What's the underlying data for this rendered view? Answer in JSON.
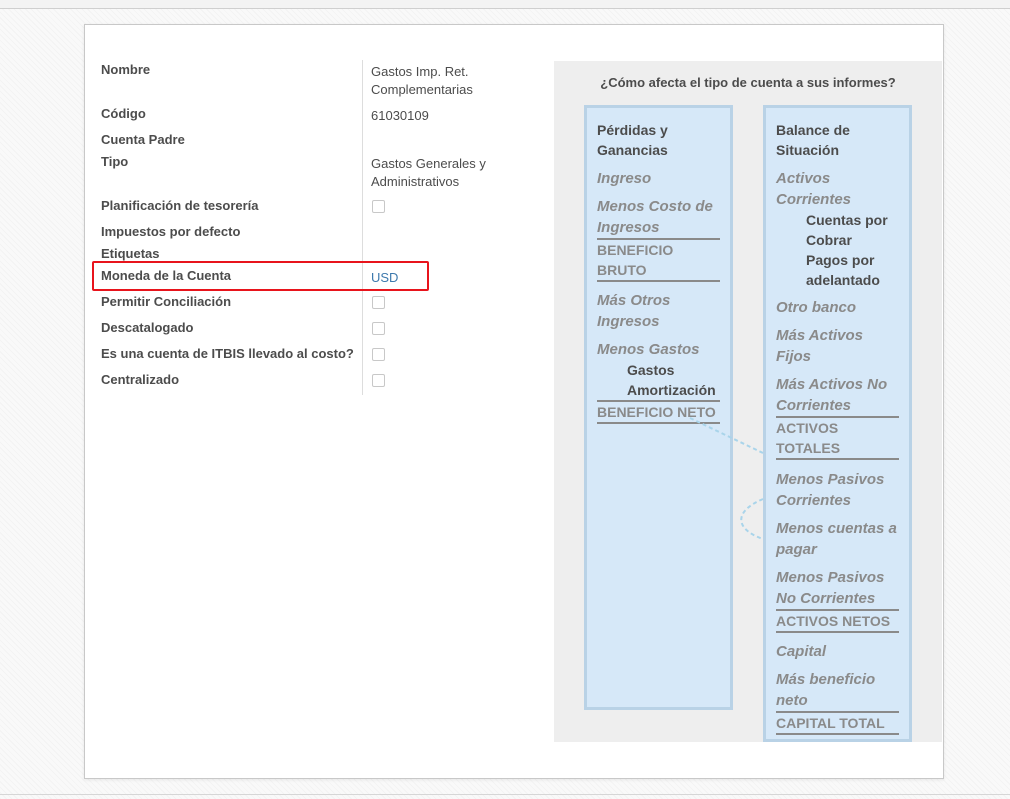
{
  "form": {
    "fields": [
      {
        "label": "Nombre",
        "value": "Gastos Imp. Ret. Complementarias"
      },
      {
        "label": "Código",
        "value": "61030109"
      },
      {
        "label": "Cuenta Padre",
        "value": ""
      },
      {
        "label": "Tipo",
        "value": "Gastos Generales y Administrativos"
      },
      {
        "label": "Planificación de tesorería",
        "checked": false
      },
      {
        "label": "Impuestos por defecto",
        "value": ""
      },
      {
        "label": "Etiquetas",
        "value": ""
      },
      {
        "label": "Moneda de la Cuenta",
        "value": "USD"
      },
      {
        "label": "Permitir Conciliación",
        "checked": false
      },
      {
        "label": "Descatalogado",
        "checked": false
      },
      {
        "label": "Es una cuenta de ITBIS llevado al costo?",
        "checked": false
      },
      {
        "label": "Centralizado",
        "checked": false
      }
    ]
  },
  "panel": {
    "title": "¿Cómo afecta el tipo de cuenta a sus informes?",
    "left": {
      "heading": "Pérdidas y Ganancias",
      "ingreso": "Ingreso",
      "menos_costo": "Menos Costo de Ingresos",
      "beneficio_bruto": "BENEFICIO BRUTO",
      "mas_otros": "Más Otros Ingresos",
      "menos_gastos": "Menos Gastos",
      "gastos_sub": "Gastos",
      "amortizacion_sub": "Amortización",
      "beneficio_neto": "BENEFICIO NETO"
    },
    "right": {
      "heading": "Balance de Situación",
      "activos_corrientes": "Activos Corrientes",
      "cuentas_cobrar": "Cuentas por Cobrar",
      "pagos_adelantado": "Pagos por adelantado",
      "otro_banco": "Otro banco",
      "mas_activos_fijos": "Más Activos Fijos",
      "mas_activos_no_corr": "Más Activos No Corrientes",
      "activos_totales": "ACTIVOS TOTALES",
      "menos_pasivos_corr": "Menos Pasivos Corrientes",
      "menos_cuentas_pagar": "Menos cuentas a pagar",
      "menos_pasivos_no_corr": "Menos Pasivos No Corrientes",
      "activos_netos": "ACTIVOS NETOS",
      "capital": "Capital",
      "mas_beneficio_neto": "Más beneficio neto",
      "capital_total": "CAPITAL TOTAL"
    }
  },
  "colors": {
    "highlight": "#e8141c",
    "link": "#3d79ad",
    "column_bg": "#d6e8f8",
    "column_border": "#b9d2e6",
    "panel_bg": "#eeeeee",
    "connector": "#a9d4ea"
  }
}
